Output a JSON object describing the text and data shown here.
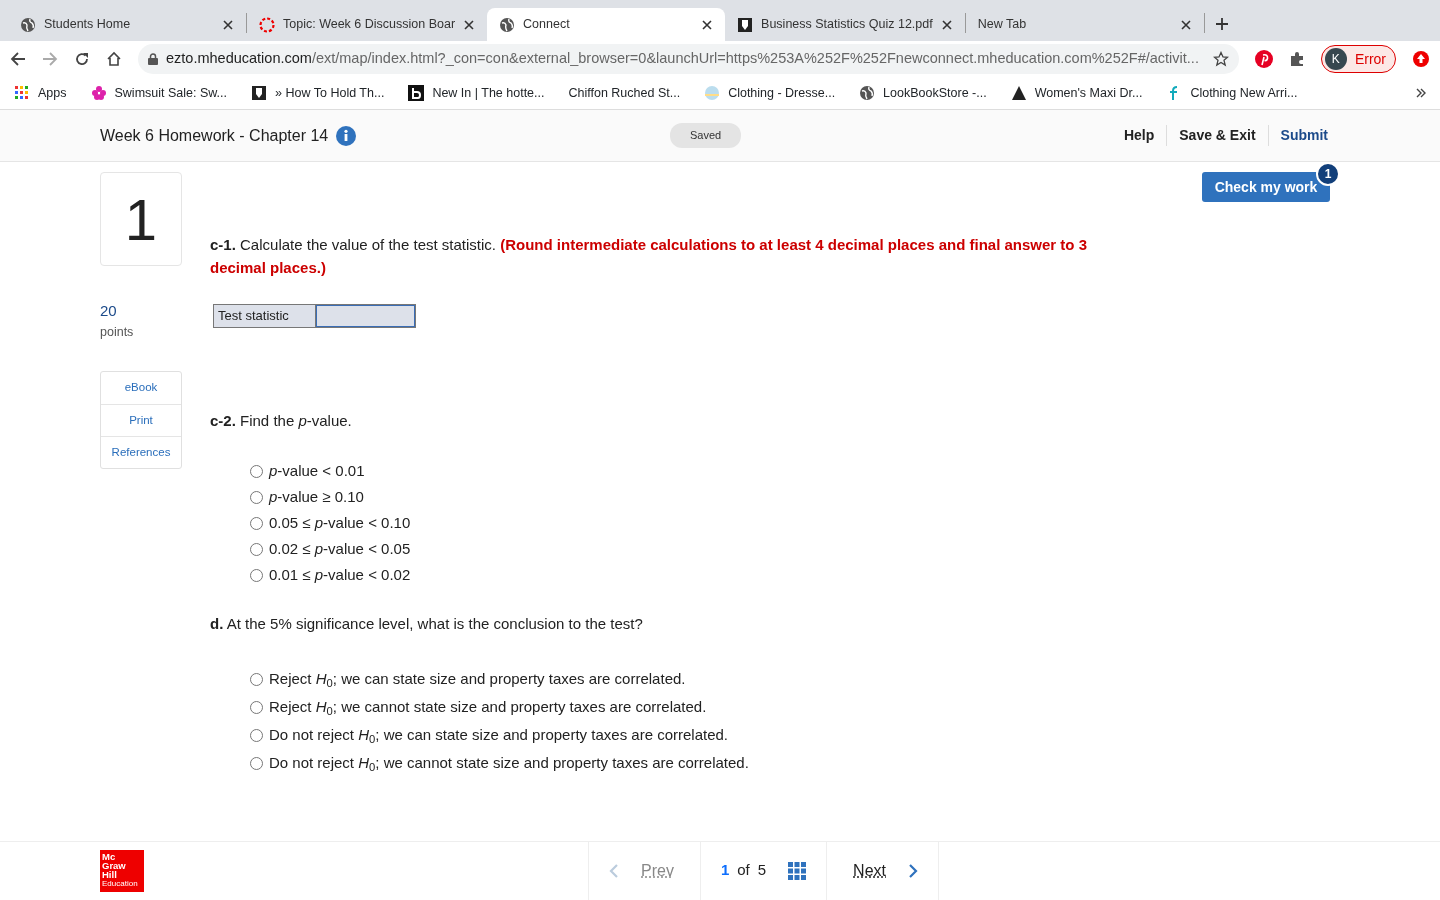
{
  "browser": {
    "tabs": [
      {
        "title": "Students Home",
        "selected": false
      },
      {
        "title": "Topic: Week 6 Discussion Boar",
        "selected": false
      },
      {
        "title": "Connect",
        "selected": true
      },
      {
        "title": "Business Statistics Quiz 12.pdf",
        "selected": false
      },
      {
        "title": "New Tab",
        "selected": false
      }
    ],
    "address": {
      "host": "ezto.mheducation.com",
      "path": "/ext/map/index.html?_con=con&external_browser=0&launchUrl=https%253A%252F%252Fnewconnect.mheducation.com%252F#/activit..."
    },
    "profile": {
      "initial": "K",
      "status": "Error"
    },
    "bookmarks": [
      "Apps",
      "Swimsuit Sale: Sw...",
      "» How To Hold Th...",
      "New In | The hotte...",
      "Chiffon Ruched St...",
      "Clothing - Dresse...",
      "LookBookStore -...",
      "Women's Maxi Dr...",
      "Clothing New Arri..."
    ]
  },
  "header": {
    "title": "Week 6 Homework - Chapter 14",
    "status": "Saved",
    "links": [
      "Help",
      "Save & Exit",
      "Submit"
    ]
  },
  "check_button": {
    "label": "Check my work",
    "badge": "1"
  },
  "question": {
    "number": "1",
    "points": "20",
    "points_label": "points",
    "resources": [
      "eBook",
      "Print",
      "References"
    ]
  },
  "parts": [
    {
      "kind": "input",
      "label": "c-1.",
      "text": "Calculate the value of the test statistic.",
      "note": "(Round intermediate calculations to at least 4 decimal places and final answer to 3 decimal places.)",
      "field_label": "Test statistic"
    },
    {
      "kind": "choice",
      "label": "c-2.",
      "text": "Find the *p*-value.",
      "options": [
        {
          "text": "*p*-value < 0.01",
          "selected": false
        },
        {
          "text": "*p*-value ≥ 0.10",
          "selected": false
        },
        {
          "text": "0.05 ≤ *p*-value < 0.10",
          "selected": false
        },
        {
          "text": "0.02 ≤ *p*-value < 0.05",
          "selected": false
        },
        {
          "text": "0.01 ≤ *p*-value < 0.02",
          "selected": false
        }
      ]
    },
    {
      "kind": "choice",
      "label": "d.",
      "text": "At the 5% significance level, what is the conclusion to the test?",
      "options": [
        {
          "text": "Reject *H*$_{0}$; we can state size and property taxes are correlated.",
          "selected": false
        },
        {
          "text": "Reject *H*$_{0}$; we cannot state size and property taxes are correlated.",
          "selected": false
        },
        {
          "text": "Do not reject *H*$_{0}$; we can state size and property taxes are correlated.",
          "selected": false
        },
        {
          "text": "Do not reject *H*$_{0}$; we cannot state size and property taxes are correlated.",
          "selected": false
        }
      ]
    }
  ],
  "footer": {
    "logo": [
      "Mc",
      "Graw",
      "Hill",
      "Education"
    ],
    "prev": {
      "label": "Prev",
      "disabled": true
    },
    "page": "1",
    "of": "of",
    "total": "5",
    "next": {
      "label": "Next",
      "disabled": false
    }
  }
}
